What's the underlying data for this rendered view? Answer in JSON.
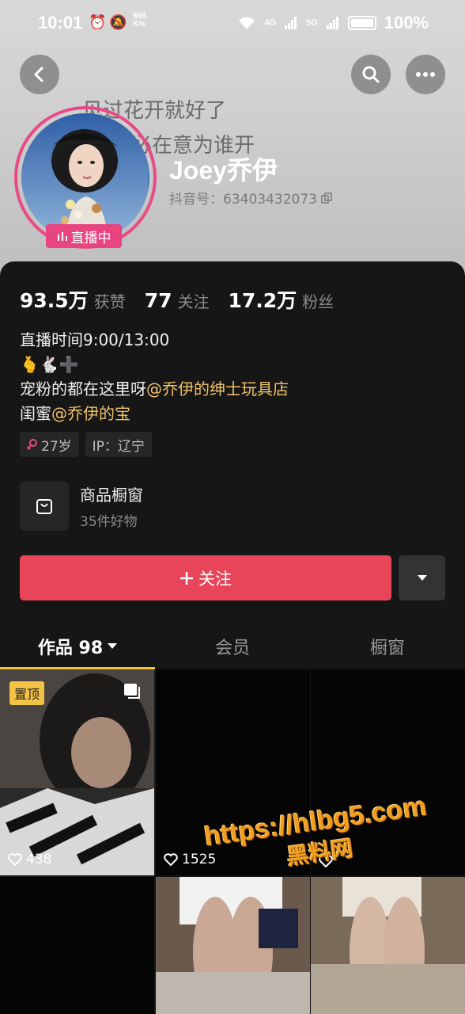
{
  "status_bar": {
    "time": "10:01",
    "speed_value": "598",
    "speed_unit": "K/s",
    "net1": "4G",
    "net2": "5G",
    "battery": "100%"
  },
  "header": {
    "background_text_line1": "见过花开就好了",
    "background_text_line2": "何必在意为谁开",
    "nickname": "Joey乔伊",
    "douyin_id": "抖音号：63403432073",
    "live_badge": "直播中"
  },
  "stats": [
    {
      "value": "93.5万",
      "label": "获赞"
    },
    {
      "value": "77",
      "label": "关注"
    },
    {
      "value": "17.2万",
      "label": "粉丝"
    }
  ],
  "bio": {
    "line1": "直播时间9:00/13:00",
    "line2_emoji": "🫰🐇➕",
    "line3_prefix": "宠粉的都在这里呀",
    "line3_mention": "@乔伊的绅士玩具店",
    "line4_prefix": "闺蜜",
    "line4_mention": "@乔伊的宝"
  },
  "tags": {
    "age": "27岁",
    "ip": "IP：辽宁",
    "gender_color": "#e84a86"
  },
  "shop": {
    "title": "商品橱窗",
    "subtitle": "35件好物"
  },
  "actions": {
    "follow_label": "关注",
    "follow_color": "#e8445a"
  },
  "tabs": [
    {
      "label": "作品 98",
      "active": true
    },
    {
      "label": "会员",
      "active": false
    },
    {
      "label": "橱窗",
      "active": false
    }
  ],
  "videos": [
    {
      "pinned_label": "置顶",
      "likes": "438"
    },
    {
      "likes": "1525"
    },
    {
      "likes": ""
    }
  ],
  "watermark": {
    "url": "https://hlbg5.com",
    "name": "黑料网"
  }
}
